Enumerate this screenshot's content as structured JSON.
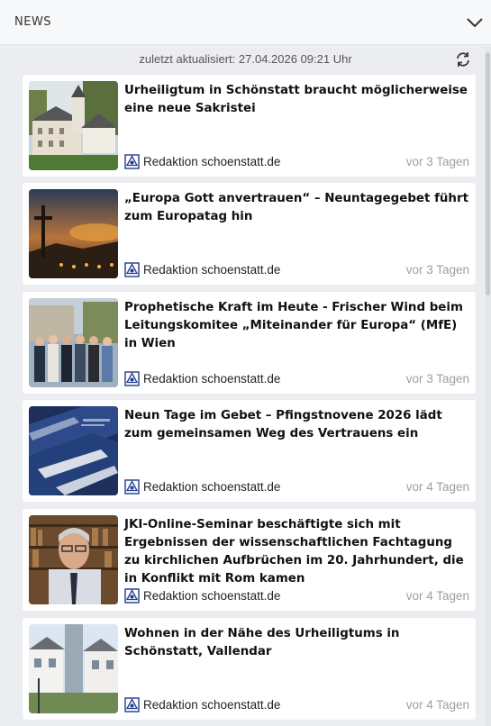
{
  "header": {
    "title": "NEWS"
  },
  "updated": {
    "text": "zuletzt aktualisiert: 27.04.2026 09:21 Uhr"
  },
  "icons": {
    "collapse": "chevron-down-icon",
    "refresh": "refresh-icon",
    "publisher": "schoenstatt-logo-icon"
  },
  "colors": {
    "background": "#ebedf0",
    "card": "#ffffff",
    "muted": "#9aa0a6",
    "logo": "#1f3c8c"
  },
  "news": [
    {
      "title": "Urheiligtum in Schönstatt braucht möglicherweise eine neue Sakristei",
      "author": "Redaktion schoenstatt.de",
      "age": "vor 3 Tagen"
    },
    {
      "title": "„Europa Gott anvertrauen“ – Neuntagegebet führt zum Europatag hin",
      "author": "Redaktion schoenstatt.de",
      "age": "vor 3 Tagen"
    },
    {
      "title": "Prophetische Kraft im Heute - Frischer Wind beim Leitungskomitee „Miteinander für Europa“ (MfE) in Wien",
      "author": "Redaktion schoenstatt.de",
      "age": "vor 3 Tagen"
    },
    {
      "title": "Neun Tage im Gebet – Pfingstnovene 2026 lädt zum gemeinsamen Weg des Vertrauens ein",
      "author": "Redaktion schoenstatt.de",
      "age": "vor 4 Tagen"
    },
    {
      "title": "JKI-Online-Seminar beschäftigte sich mit Ergebnissen der wissenschaftlichen Fachtagung zu kirchlichen Aufbrüchen im 20. Jahrhundert, die in Konflikt mit Rom kamen",
      "author": "Redaktion schoenstatt.de",
      "age": "vor 4 Tagen"
    },
    {
      "title": "Wohnen in der Nähe des Urheiligtums in Schönstatt, Vallendar",
      "author": "Redaktion schoenstatt.de",
      "age": "vor 4 Tagen"
    }
  ]
}
